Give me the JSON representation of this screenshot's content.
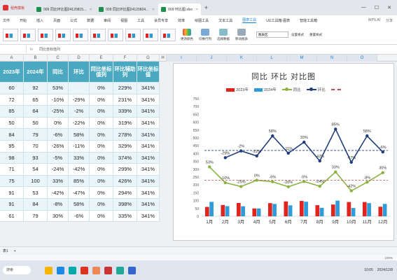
{
  "titlebar": {
    "app": "稻壳模板",
    "tabs": [
      {
        "label": "009 同比环比图24120815...",
        "active": false
      },
      {
        "label": "009 同比环比图24120824...",
        "active": false
      },
      {
        "label": "009 环比图.xlsx",
        "active": true
      }
    ]
  },
  "menubar": {
    "items": [
      "文件",
      "开始",
      "插入",
      "页面",
      "公式",
      "数据",
      "审阅",
      "视图",
      "工具",
      "会员专享",
      "效率",
      "绘图工具",
      "文本工具",
      "图表工具",
      "UU工具箱-图表",
      "智能工具箱"
    ],
    "active": "图表工具",
    "right": [
      "WPS AI",
      "分享"
    ]
  },
  "ribbon": {
    "buttons": [
      "更改颜色",
      "切换行列",
      "选择数据",
      "移动图表",
      "设置格式",
      "重置样式"
    ],
    "select_value": "图表区"
  },
  "formulabar": {
    "namebox": "",
    "fx": "fx",
    "text": "同比坐标值列"
  },
  "columns": [
    "A",
    "B",
    "C",
    "D",
    "E",
    "F",
    "G",
    "H",
    "I",
    "J",
    "K",
    "L",
    "M",
    "N",
    "O"
  ],
  "table": {
    "headers": [
      "2023年",
      "2024年",
      "同比",
      "环比",
      "同比坐标值列",
      "环比辅助列",
      "环比坐标值"
    ],
    "rows": [
      [
        "60",
        "92",
        "53%",
        "",
        "0%",
        "229%",
        "341%"
      ],
      [
        "72",
        "65",
        "-10%",
        "-29%",
        "0%",
        "231%",
        "341%"
      ],
      [
        "85",
        "64",
        "-25%",
        "-2%",
        "0%",
        "339%",
        "341%"
      ],
      [
        "50",
        "50",
        "0%",
        "-22%",
        "0%",
        "319%",
        "341%"
      ],
      [
        "84",
        "79",
        "-6%",
        "58%",
        "0%",
        "278%",
        "341%"
      ],
      [
        "95",
        "70",
        "-26%",
        "-11%",
        "0%",
        "329%",
        "341%"
      ],
      [
        "98",
        "93",
        "-5%",
        "33%",
        "0%",
        "374%",
        "341%"
      ],
      [
        "71",
        "54",
        "-24%",
        "-42%",
        "0%",
        "299%",
        "341%"
      ],
      [
        "75",
        "100",
        "33%",
        "85%",
        "0%",
        "426%",
        "341%"
      ],
      [
        "91",
        "53",
        "-42%",
        "-47%",
        "0%",
        "294%",
        "341%"
      ],
      [
        "91",
        "84",
        "-8%",
        "58%",
        "0%",
        "398%",
        "341%"
      ],
      [
        "61",
        "79",
        "30%",
        "-6%",
        "0%",
        "335%",
        "341%"
      ]
    ]
  },
  "chart_data": {
    "type": "bar",
    "title": "同比 环比 对比图",
    "categories": [
      "1月",
      "2月",
      "3月",
      "4月",
      "5月",
      "6月",
      "7月",
      "8月",
      "9月",
      "10月",
      "11月",
      "12月"
    ],
    "series": [
      {
        "name": "2023年",
        "type": "bar",
        "color": "#e3231d",
        "values": [
          60,
          72,
          85,
          50,
          84,
          95,
          98,
          71,
          75,
          91,
          91,
          61
        ]
      },
      {
        "name": "2024年",
        "type": "bar",
        "color": "#2f9bd8",
        "values": [
          92,
          65,
          64,
          50,
          79,
          70,
          93,
          54,
          100,
          53,
          84,
          79
        ]
      },
      {
        "name": "同比",
        "type": "line",
        "color": "#8cb342",
        "values": [
          53,
          -10,
          -25,
          0,
          -6,
          -26,
          -5,
          -24,
          33,
          -42,
          -8,
          30
        ],
        "labels": [
          "53%",
          "-10%",
          "-25%",
          "0%",
          "-6%",
          "-26%",
          "-5%",
          "-24%",
          "33%",
          "-42%",
          "-8%",
          "30%"
        ]
      },
      {
        "name": "环比",
        "type": "line",
        "color": "#1f3e7a",
        "values": [
          null,
          -29,
          -2,
          -22,
          58,
          -11,
          33,
          -42,
          85,
          -47,
          58,
          -6
        ],
        "labels": [
          "",
          "-29%",
          "-2%",
          "-22%",
          "58%",
          "-11%",
          "33%",
          "-42%",
          "85%",
          "-47%",
          "58%",
          "-6%"
        ]
      }
    ],
    "yaxis_ticks": [
      "0",
      "50",
      "100",
      "150",
      "200",
      "250",
      "300",
      "350",
      "400",
      "450",
      "500",
      "550",
      "600",
      "650",
      "700",
      "750"
    ],
    "ylim": [
      0,
      750
    ],
    "legend": "top",
    "grid": false
  },
  "sheetbar": {
    "tabs": [
      "表1",
      "+"
    ]
  },
  "statusbar": {
    "zoom": "100%"
  },
  "taskbar": {
    "search": "搜索",
    "time": "10:05",
    "date": "2024/12/8"
  }
}
